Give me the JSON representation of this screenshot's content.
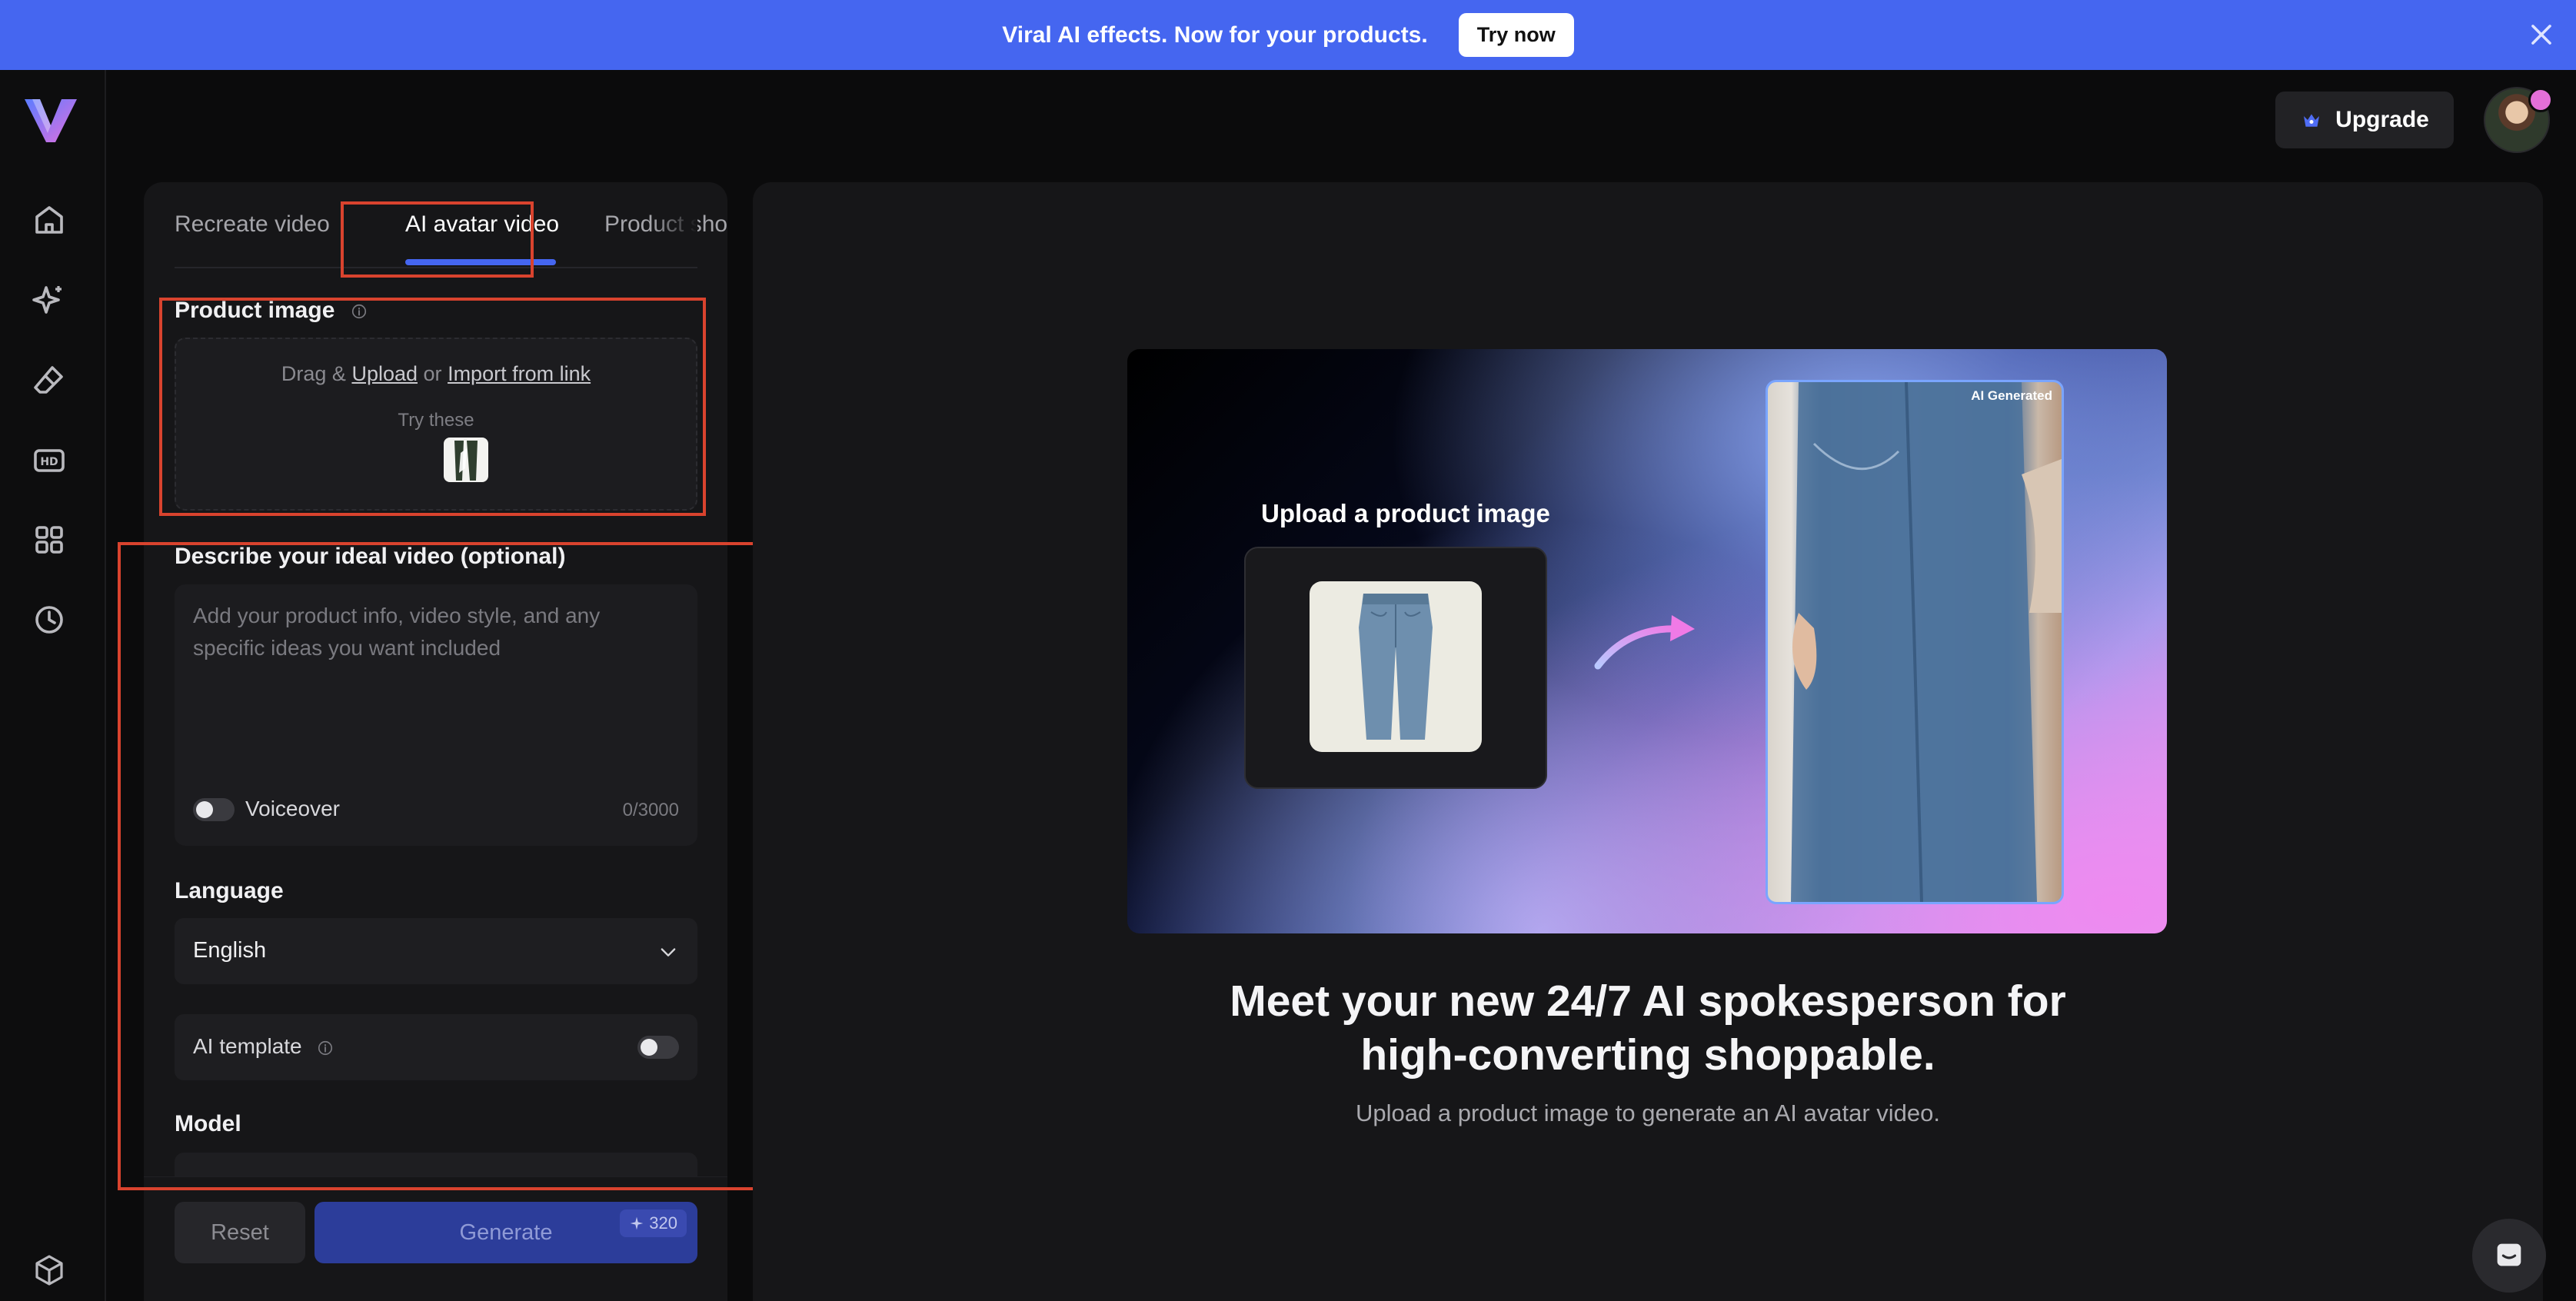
{
  "banner": {
    "text": "Viral AI effects. Now for your products.",
    "cta": "Try now"
  },
  "header": {
    "upgrade_label": "Upgrade"
  },
  "sidebar": {
    "icons": [
      "home-icon",
      "sparkle-icon",
      "eraser-icon",
      "hd-icon",
      "apps-icon",
      "history-icon",
      "box-icon"
    ]
  },
  "tabs": [
    {
      "label": "Recreate video"
    },
    {
      "label": "AI avatar video",
      "active": true
    },
    {
      "label": "Product sho"
    }
  ],
  "form": {
    "product_image_label": "Product image",
    "upload_drag": "Drag &",
    "upload_link": "Upload",
    "upload_or": "or",
    "import_link": "Import from link",
    "try_these": "Try these",
    "describe_label": "Describe your ideal video (optional)",
    "describe_placeholder": "Add your product info, video style, and any specific ideas you want included",
    "voiceover_label": "Voiceover",
    "char_counter": "0/3000",
    "language_label": "Language",
    "language_value": "English",
    "ai_template_label": "AI template",
    "model_label": "Model"
  },
  "actions": {
    "reset_label": "Reset",
    "generate_label": "Generate",
    "credits": "320"
  },
  "hero": {
    "upload_label": "Upload a product image",
    "ai_tag": "AI Generated",
    "headline_line1": "Meet your new 24/7 AI spokesperson for",
    "headline_line2": "high-converting shoppable.",
    "subline": "Upload a product image to generate an AI avatar video."
  },
  "colors": {
    "accent": "#4566f0",
    "annotation": "#d9432e",
    "panel": "#161618"
  }
}
